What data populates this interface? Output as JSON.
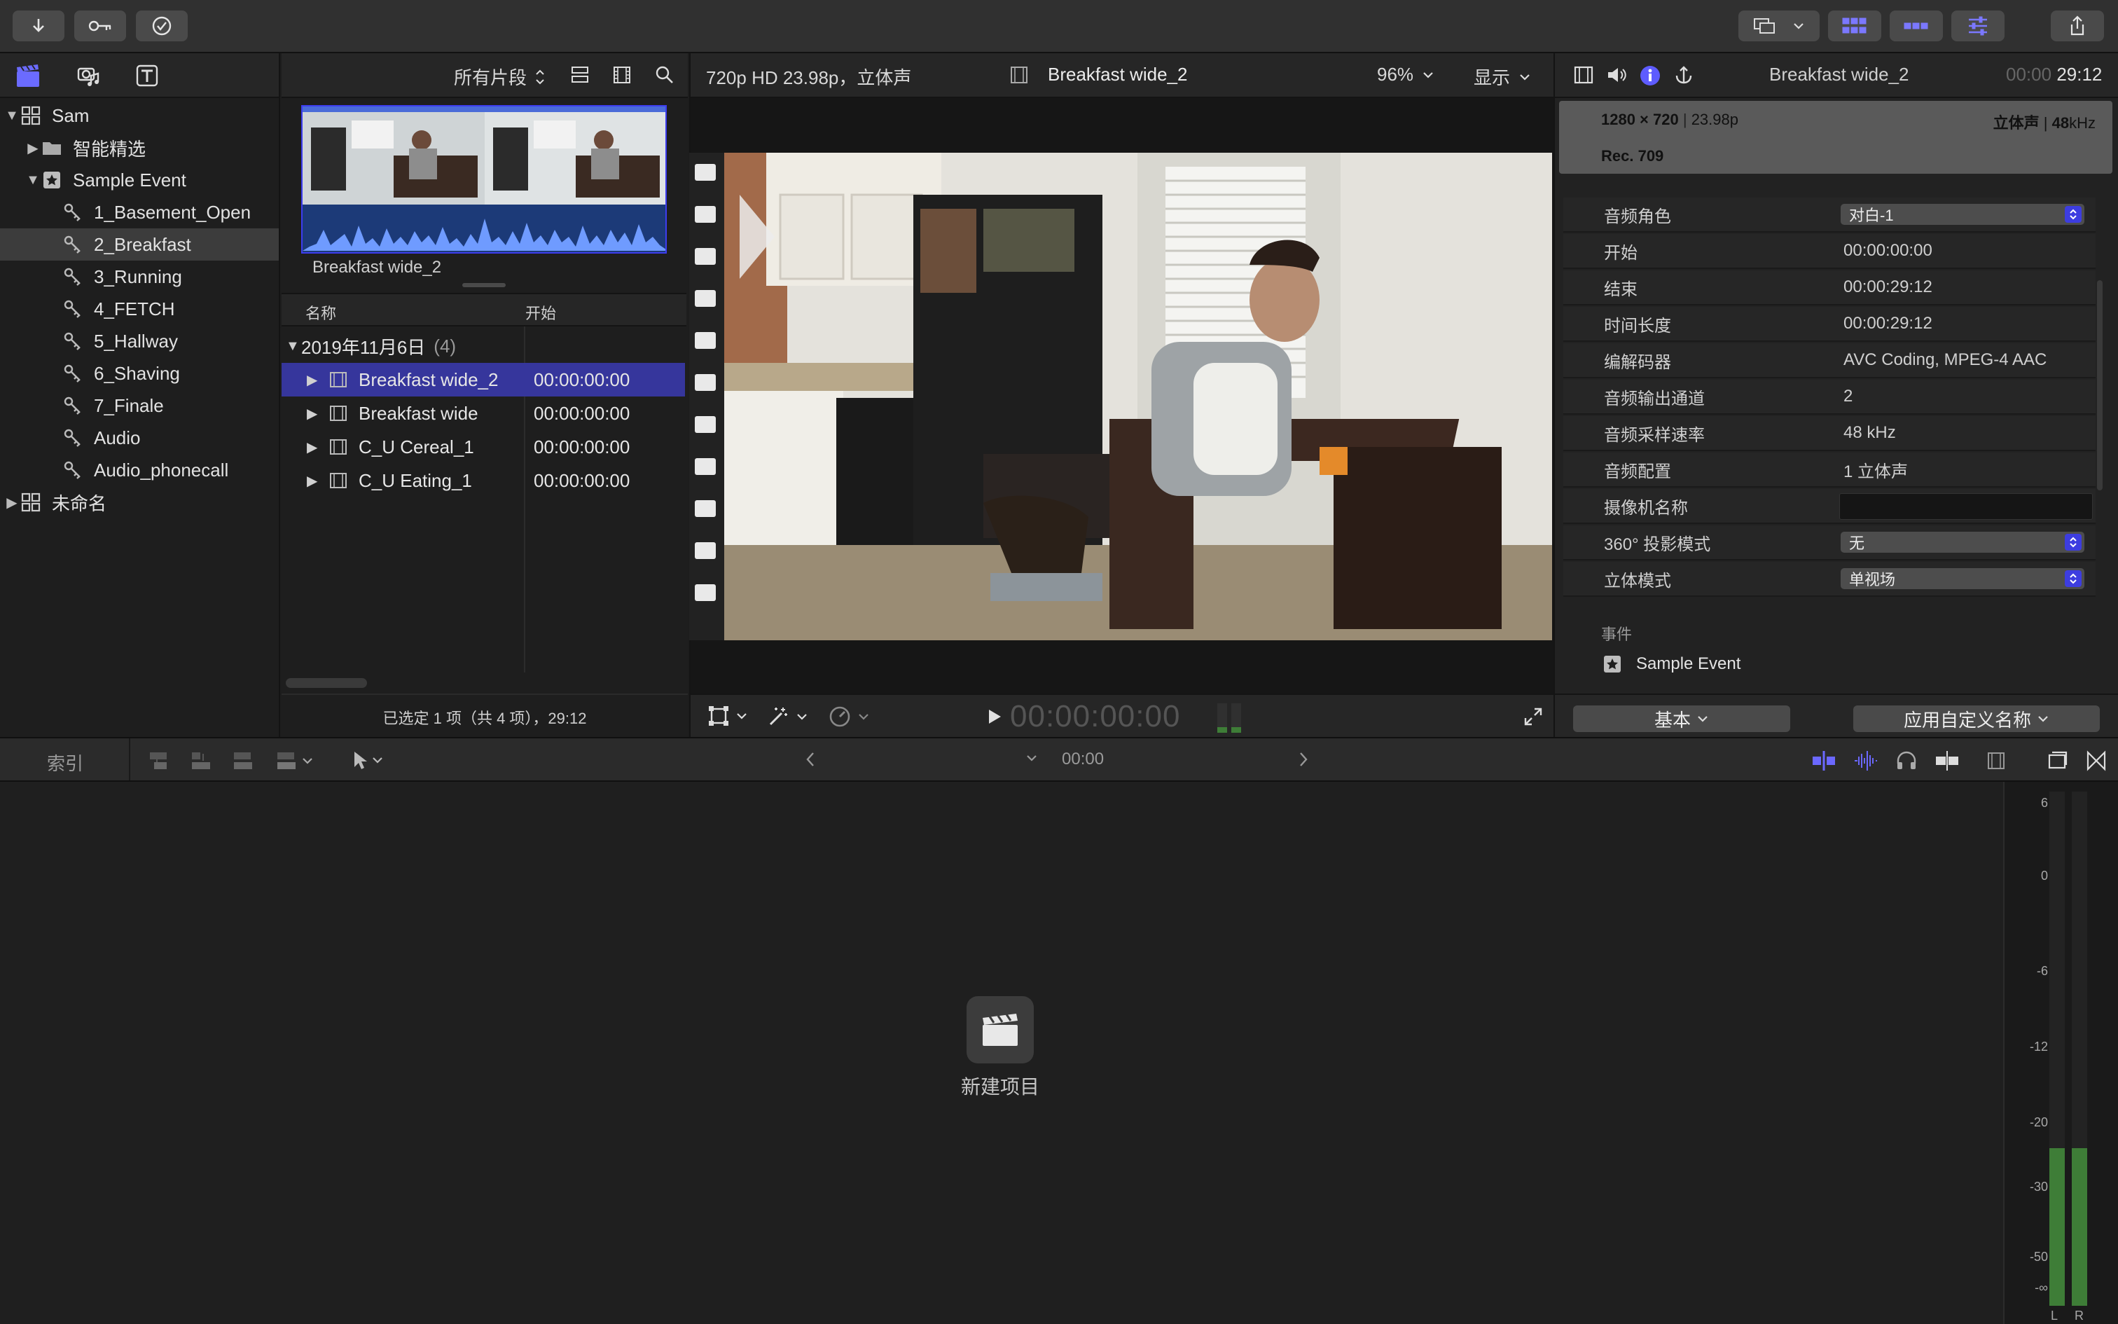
{
  "colors": {
    "accent": "#3d3df0",
    "selected_row": "#36369c",
    "meter_green": "#3e7d37"
  },
  "library": {
    "items": [
      {
        "label": "Sam",
        "icon": "library-grid-icon",
        "indent": 0,
        "expanded": true
      },
      {
        "label": "智能精选",
        "icon": "folder-icon",
        "indent": 1,
        "expanded": false
      },
      {
        "label": "Sample Event",
        "icon": "star-event-icon",
        "indent": 1,
        "expanded": true
      },
      {
        "label": "1_Basement_Open",
        "icon": "keyword-icon",
        "indent": 2
      },
      {
        "label": "2_Breakfast",
        "icon": "keyword-icon",
        "indent": 2,
        "selected": true
      },
      {
        "label": "3_Running",
        "icon": "keyword-icon",
        "indent": 2
      },
      {
        "label": "4_FETCH",
        "icon": "keyword-icon",
        "indent": 2
      },
      {
        "label": "5_Hallway",
        "icon": "keyword-icon",
        "indent": 2
      },
      {
        "label": "6_Shaving",
        "icon": "keyword-icon",
        "indent": 2
      },
      {
        "label": "7_Finale",
        "icon": "keyword-icon",
        "indent": 2
      },
      {
        "label": "Audio",
        "icon": "keyword-icon",
        "indent": 2
      },
      {
        "label": "Audio_phonecall",
        "icon": "keyword-icon",
        "indent": 2
      },
      {
        "label": "未命名",
        "icon": "library-grid-icon",
        "indent": 0,
        "expanded": false
      }
    ]
  },
  "browser": {
    "filter_label": "所有片段",
    "thumbnail_caption": "Breakfast wide_2",
    "columns": {
      "name": "名称",
      "start": "开始"
    },
    "group": {
      "date": "2019年11月6日",
      "count": "(4)"
    },
    "clips": [
      {
        "name": "Breakfast wide_2",
        "start": "00:00:00:00",
        "selected": true
      },
      {
        "name": "Breakfast wide",
        "start": "00:00:00:00"
      },
      {
        "name": "C_U Cereal_1",
        "start": "00:00:00:00"
      },
      {
        "name": "C_U Eating_1",
        "start": "00:00:00:00"
      }
    ],
    "status": "已选定 1 项（共 4 项），29:12"
  },
  "viewer": {
    "format": "720p HD 23.98p，立体声",
    "clip_title": "Breakfast wide_2",
    "zoom": "96%",
    "display_label": "显示",
    "timecode": "00:00:00:00"
  },
  "inspector": {
    "title": "Breakfast wide_2",
    "duration_dim": "00:00",
    "duration": "29:12",
    "info": {
      "resolution": "1280 × 720",
      "rate": "23.98p",
      "audio": "立体声",
      "sample": "48",
      "sample_unit": "kHz",
      "color_space": "Rec. 709"
    },
    "rows": [
      {
        "label": "音频角色",
        "value": "对白-1",
        "type": "popup"
      },
      {
        "label": "开始",
        "value": "00:00:00:00"
      },
      {
        "label": "结束",
        "value": "00:00:29:12"
      },
      {
        "label": "时间长度",
        "value": "00:00:29:12"
      },
      {
        "label": "编解码器",
        "value": "AVC Coding, MPEG-4 AAC"
      },
      {
        "label": "音频输出通道",
        "value": "2"
      },
      {
        "label": "音频采样速率",
        "value": "48 kHz"
      },
      {
        "label": "音频配置",
        "value": "1 立体声"
      },
      {
        "label": "摄像机名称",
        "value": "",
        "type": "field"
      },
      {
        "label": "360° 投影模式",
        "value": "无",
        "type": "popup"
      },
      {
        "label": "立体模式",
        "value": "单视场",
        "type": "popup"
      }
    ],
    "event_label": "事件",
    "event_name": "Sample Event",
    "basic_button": "基本",
    "custom_name_button": "应用自定义名称"
  },
  "timeline": {
    "index_label": "索引",
    "timecode": "00:00",
    "new_project": "新建项目"
  },
  "meter": {
    "labels": [
      "6",
      "0",
      "-6",
      "-12",
      "-20",
      "-30",
      "-50",
      "-∞"
    ],
    "channels": [
      "L",
      "R"
    ],
    "level_db": -24
  }
}
